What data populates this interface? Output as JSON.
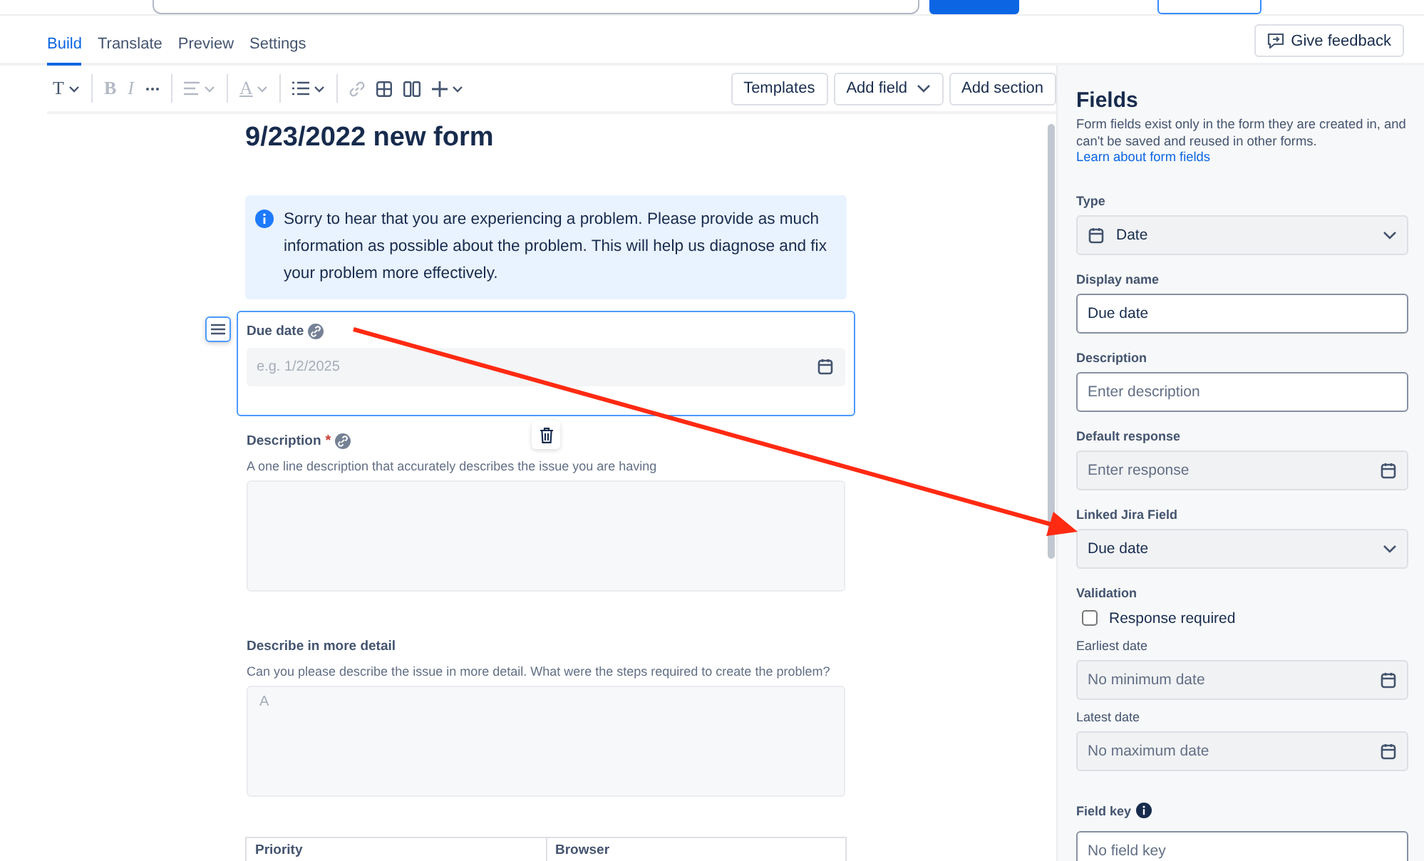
{
  "tabs": [
    {
      "label": "Build",
      "selected": true
    },
    {
      "label": "Translate",
      "selected": false
    },
    {
      "label": "Preview",
      "selected": false
    },
    {
      "label": "Settings",
      "selected": false
    }
  ],
  "feedback_button": "Give feedback",
  "format_tools": [
    {
      "kind": "text-style",
      "glyph": "T",
      "disabled": false,
      "divider_after": true
    },
    {
      "kind": "bold",
      "glyph": "B",
      "disabled": true,
      "divider_after": false
    },
    {
      "kind": "italic",
      "glyph": "I",
      "disabled": true,
      "divider_after": false
    },
    {
      "kind": "more",
      "disabled": false,
      "divider_after": true
    },
    {
      "kind": "align",
      "disabled": true,
      "divider_after": true
    },
    {
      "kind": "color",
      "glyph": "A",
      "disabled": true,
      "divider_after": true
    },
    {
      "kind": "list",
      "disabled": false,
      "divider_after": true
    },
    {
      "kind": "link",
      "disabled": true,
      "divider_after": false
    },
    {
      "kind": "table",
      "disabled": false,
      "divider_after": false
    },
    {
      "kind": "columns",
      "disabled": false,
      "divider_after": false
    },
    {
      "kind": "insert",
      "disabled": false,
      "divider_after": false
    }
  ],
  "toolbar_buttons": [
    {
      "label": "Templates",
      "kind": "plain"
    },
    {
      "label": "Add field",
      "kind": "dropdown"
    },
    {
      "label": "Add section",
      "kind": "plain"
    }
  ],
  "form": {
    "title": "9/23/2022 new form",
    "info": "Sorry to hear that you are experiencing a problem. Please provide as much information as possible about the problem. This will help us diagnose and fix your problem more effectively.",
    "fields": [
      {
        "kind": "date",
        "label": "Due date",
        "linked": true,
        "selected": true,
        "placeholder": "e.g. 1/2/2025"
      },
      {
        "kind": "paragraph",
        "label": "Description",
        "required_mark": "*",
        "linked": true,
        "selected": false,
        "help": "A one line description that accurately describes the issue you are having"
      },
      {
        "kind": "paragraph",
        "label": "Describe in more detail",
        "linked": false,
        "selected": false,
        "help": "Can you please describe the issue in more detail. What were the steps required to create the problem?",
        "placeholder": "A"
      }
    ],
    "table": {
      "columns": [
        "Priority",
        "Browser"
      ]
    }
  },
  "panel": {
    "title": "Fields",
    "description": "Form fields exist only in the form they are created in, and can't be saved and reused in other forms.",
    "link": "Learn about form fields",
    "type": {
      "label": "Type",
      "value": "Date"
    },
    "display_name": {
      "label": "Display name",
      "value": "Due date"
    },
    "description_field": {
      "label": "Description",
      "placeholder": "Enter description"
    },
    "default_response": {
      "label": "Default response",
      "placeholder": "Enter response"
    },
    "linked_field": {
      "label": "Linked Jira Field",
      "value": "Due date"
    },
    "validation": {
      "label": "Validation",
      "response_required": {
        "label": "Response required",
        "checked": false
      },
      "earliest": {
        "label": "Earliest date",
        "placeholder": "No minimum date"
      },
      "latest": {
        "label": "Latest date",
        "placeholder": "No maximum date"
      }
    },
    "field_key": {
      "label": "Field key",
      "placeholder": "No field key"
    }
  }
}
